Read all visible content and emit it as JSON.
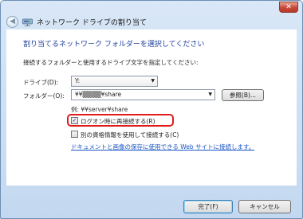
{
  "window": {
    "title": "ネットワーク ドライブの割り当て",
    "back_glyph": "◀",
    "close_glyph": "✕"
  },
  "content": {
    "heading": "割り当てるネットワーク フォルダーを選択してください",
    "instruction": "接続するフォルダーと使用するドライブ文字を指定してください:",
    "drive": {
      "label": "ドライブ(D):",
      "value": "Y:"
    },
    "folder": {
      "label": "フォルダー(O):",
      "value": "¥¥▒▒▒▒¥share",
      "browse_label": "参照(B)..."
    },
    "example": "例: ¥¥server¥share",
    "options": {
      "reconnect": {
        "label": "ログオン時に再接続する(R)",
        "checked": true,
        "mark": "✓"
      },
      "credentials": {
        "label": "別の資格情報を使用して接続する(C)",
        "checked": false
      }
    },
    "link": "ドキュメントと画像の保存に使用できる Web サイトに接続します。"
  },
  "buttons": {
    "finish": "完了(F)",
    "cancel": "キャンセル"
  },
  "colors": {
    "heading": "#1e3f9a",
    "link": "#1b55c2",
    "highlight": "#e01b1b",
    "close": "#c7493a"
  }
}
